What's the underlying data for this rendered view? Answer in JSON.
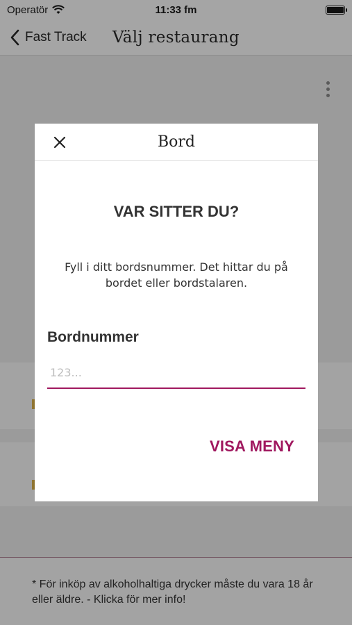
{
  "status_bar": {
    "carrier": "Operatör",
    "time": "11:33 fm",
    "battery_level": 1.0
  },
  "nav": {
    "back_label": "Fast Track",
    "title": "Välj restaurang"
  },
  "modal": {
    "title": "Bord",
    "heading": "VAR SITTER DU?",
    "description": "Fyll i ditt bordsnummer. Det hittar du på bordet eller bordstalaren.",
    "field_label": "Bordnummer",
    "field_placeholder": "123...",
    "field_value": "",
    "submit_label": "VISA MENY"
  },
  "footer": {
    "note": "* För inköp av alkoholhaltiga drycker måste du vara 18 år eller äldre. - Klicka för mer info!"
  },
  "colors": {
    "accent": "#a0185f",
    "overlay_background": "#9b9b9b",
    "modal_background": "#ffffff"
  }
}
